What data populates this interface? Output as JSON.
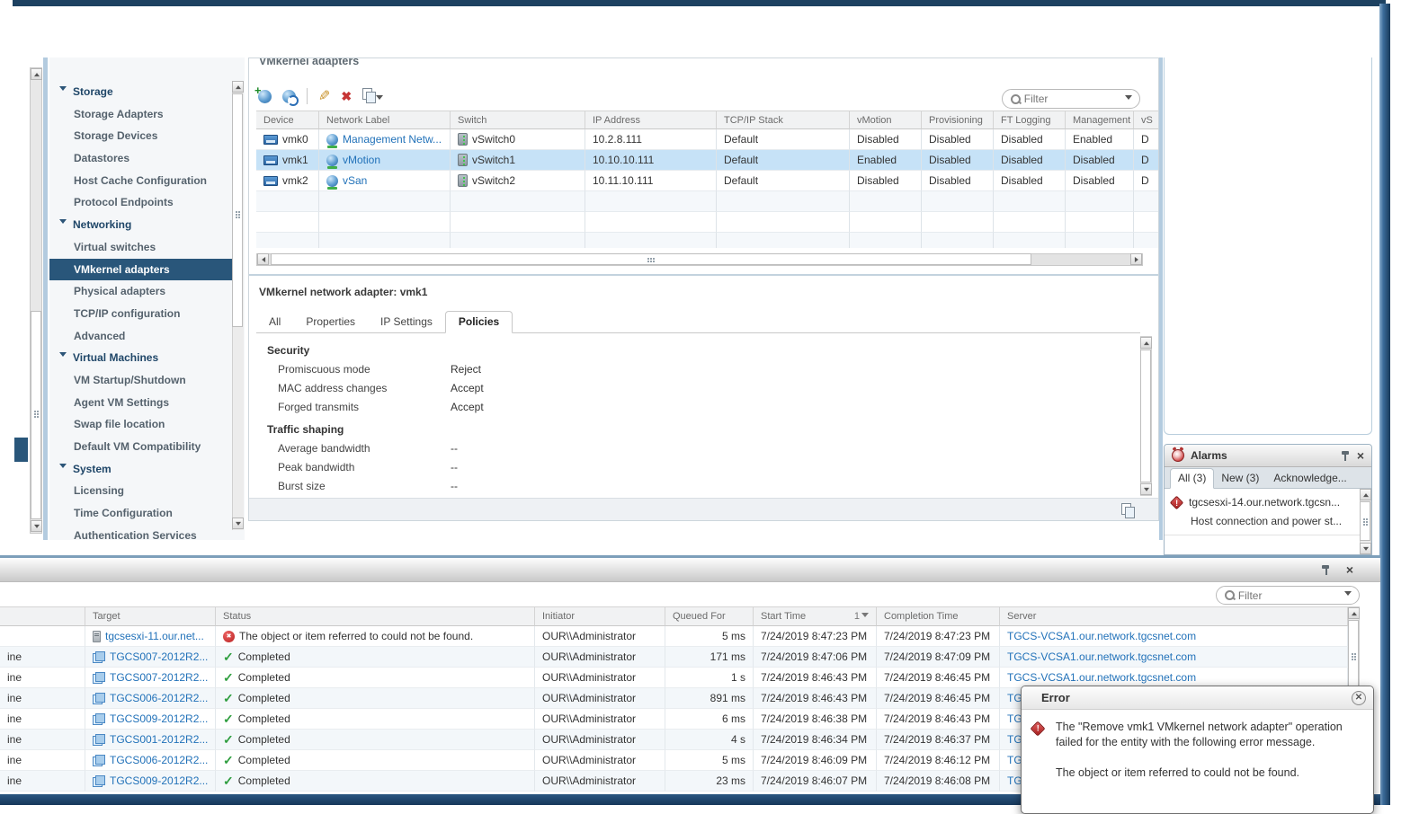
{
  "sidebar": {
    "items": [
      {
        "label": "Storage",
        "type": "section"
      },
      {
        "label": "Storage Adapters",
        "type": "item"
      },
      {
        "label": "Storage Devices",
        "type": "item"
      },
      {
        "label": "Datastores",
        "type": "item"
      },
      {
        "label": "Host Cache Configuration",
        "type": "item"
      },
      {
        "label": "Protocol Endpoints",
        "type": "item"
      },
      {
        "label": "Networking",
        "type": "section"
      },
      {
        "label": "Virtual switches",
        "type": "item"
      },
      {
        "label": "VMkernel adapters",
        "type": "item",
        "selected": true
      },
      {
        "label": "Physical adapters",
        "type": "item"
      },
      {
        "label": "TCP/IP configuration",
        "type": "item"
      },
      {
        "label": "Advanced",
        "type": "item"
      },
      {
        "label": "Virtual Machines",
        "type": "section"
      },
      {
        "label": "VM Startup/Shutdown",
        "type": "item"
      },
      {
        "label": "Agent VM Settings",
        "type": "item"
      },
      {
        "label": "Swap file location",
        "type": "item"
      },
      {
        "label": "Default VM Compatibility",
        "type": "item"
      },
      {
        "label": "System",
        "type": "section"
      },
      {
        "label": "Licensing",
        "type": "item"
      },
      {
        "label": "Time Configuration",
        "type": "item"
      },
      {
        "label": "Authentication Services",
        "type": "item"
      }
    ]
  },
  "main": {
    "title": "VMkernel adapters",
    "filter_placeholder": "Filter",
    "adapters_table": {
      "columns": [
        "Device",
        "Network Label",
        "Switch",
        "IP Address",
        "TCP/IP Stack",
        "vMotion",
        "Provisioning",
        "FT Logging",
        "Management",
        "vS"
      ],
      "rows": [
        {
          "device": "vmk0",
          "label": "Management Netw...",
          "switch": "vSwitch0",
          "ip": "10.2.8.111",
          "stack": "Default",
          "vmotion": "Disabled",
          "provisioning": "Disabled",
          "ft": "Disabled",
          "mgmt": "Enabled",
          "extra": "D"
        },
        {
          "device": "vmk1",
          "label": "vMotion",
          "switch": "vSwitch1",
          "ip": "10.10.10.111",
          "stack": "Default",
          "vmotion": "Enabled",
          "provisioning": "Disabled",
          "ft": "Disabled",
          "mgmt": "Disabled",
          "extra": "D"
        },
        {
          "device": "vmk2",
          "label": "vSan",
          "switch": "vSwitch2",
          "ip": "10.11.10.111",
          "stack": "Default",
          "vmotion": "Disabled",
          "provisioning": "Disabled",
          "ft": "Disabled",
          "mgmt": "Disabled",
          "extra": "D"
        }
      ]
    },
    "detail": {
      "title": "VMkernel network adapter: vmk1",
      "tabs": [
        "All",
        "Properties",
        "IP Settings",
        "Policies"
      ],
      "security_title": "Security",
      "security_rows": [
        {
          "label": "Promiscuous mode",
          "value": "Reject"
        },
        {
          "label": "MAC address changes",
          "value": "Accept"
        },
        {
          "label": "Forged transmits",
          "value": "Accept"
        }
      ],
      "traffic_title": "Traffic shaping",
      "traffic_rows": [
        {
          "label": "Average bandwidth",
          "value": "--"
        },
        {
          "label": "Peak bandwidth",
          "value": "--"
        },
        {
          "label": "Burst size",
          "value": "--"
        }
      ]
    }
  },
  "alarms": {
    "title": "Alarms",
    "tabs": [
      "All (3)",
      "New (3)",
      "Acknowledge..."
    ],
    "item": {
      "name": "tgcsesxi-14.our.network.tgcsn...",
      "description": "Host connection and power st..."
    }
  },
  "tasks": {
    "filter_placeholder": "Filter",
    "columns": {
      "task": "",
      "target": "Target",
      "status": "Status",
      "initiator": "Initiator",
      "queued": "Queued For",
      "start": "Start Time",
      "completion": "Completion Time",
      "server": "Server"
    },
    "sort_indicator": "1",
    "rows": [
      {
        "task": "",
        "target": "tgcsesxi-11.our.net...",
        "status": "The object or item referred to could not be found.",
        "initiator": "OUR\\\\Administrator",
        "queued": "5 ms",
        "start": "7/24/2019 8:47:23 PM",
        "completion": "7/24/2019 8:47:23 PM",
        "server": "TGCS-VCSA1.our.network.tgcsnet.com"
      },
      {
        "task": "ine",
        "target": "TGCS007-2012R2...",
        "status": "Completed",
        "initiator": "OUR\\\\Administrator",
        "queued": "171 ms",
        "start": "7/24/2019 8:47:06 PM",
        "completion": "7/24/2019 8:47:09 PM",
        "server": "TGCS-VCSA1.our.network.tgcsnet.com"
      },
      {
        "task": "ine",
        "target": "TGCS007-2012R2...",
        "status": "Completed",
        "initiator": "OUR\\\\Administrator",
        "queued": "1 s",
        "start": "7/24/2019 8:46:43 PM",
        "completion": "7/24/2019 8:46:45 PM",
        "server": "TGCS-VCSA1.our.network.tgcsnet.com"
      },
      {
        "task": "ine",
        "target": "TGCS006-2012R2...",
        "status": "Completed",
        "initiator": "OUR\\\\Administrator",
        "queued": "891 ms",
        "start": "7/24/2019 8:46:43 PM",
        "completion": "7/24/2019 8:46:45 PM",
        "server": "TGC"
      },
      {
        "task": "ine",
        "target": "TGCS009-2012R2...",
        "status": "Completed",
        "initiator": "OUR\\\\Administrator",
        "queued": "6 ms",
        "start": "7/24/2019 8:46:38 PM",
        "completion": "7/24/2019 8:46:43 PM",
        "server": "TGC"
      },
      {
        "task": "ine",
        "target": "TGCS001-2012R2...",
        "status": "Completed",
        "initiator": "OUR\\\\Administrator",
        "queued": "4 s",
        "start": "7/24/2019 8:46:34 PM",
        "completion": "7/24/2019 8:46:37 PM",
        "server": "TGC"
      },
      {
        "task": "ine",
        "target": "TGCS006-2012R2...",
        "status": "Completed",
        "initiator": "OUR\\\\Administrator",
        "queued": "5 ms",
        "start": "7/24/2019 8:46:09 PM",
        "completion": "7/24/2019 8:46:12 PM",
        "server": "TGC"
      },
      {
        "task": "ine",
        "target": "TGCS009-2012R2...",
        "status": "Completed",
        "initiator": "OUR\\\\Administrator",
        "queued": "23 ms",
        "start": "7/24/2019 8:46:07 PM",
        "completion": "7/24/2019 8:46:08 PM",
        "server": "TGC"
      }
    ]
  },
  "error_dialog": {
    "title": "Error",
    "message_line1": "The \"Remove vmk1 VMkernel network adapter\" operation failed for the entity with the following error message.",
    "message_line2": "The object or item referred to could not be found."
  }
}
